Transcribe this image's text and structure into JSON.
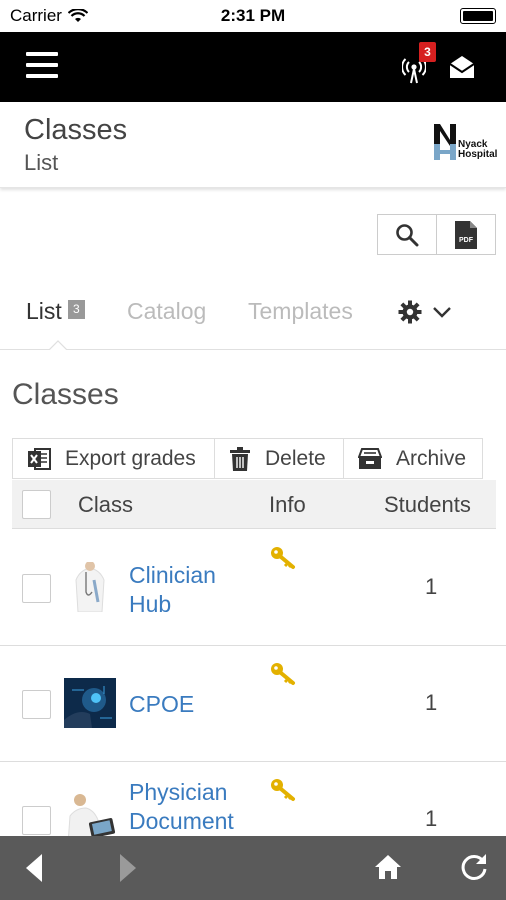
{
  "status_bar": {
    "carrier": "Carrier",
    "time": "2:31 PM"
  },
  "app_nav": {
    "notifications_count": "3"
  },
  "header": {
    "title": "Classes",
    "subtitle": "List",
    "logo_text_line1": "Nyack",
    "logo_text_line2": "Hospital"
  },
  "tool_buttons": {
    "pdf_label": "PDF"
  },
  "tabs": [
    {
      "label": "List",
      "count": "3"
    },
    {
      "label": "Catalog"
    },
    {
      "label": "Templates"
    }
  ],
  "section_title": "Classes",
  "actions": {
    "export": "Export grades",
    "delete": "Delete",
    "archive": "Archive"
  },
  "table": {
    "headers": {
      "class": "Class",
      "info": "Info",
      "students": "Students"
    },
    "rows": [
      {
        "name_line1": "Clinician",
        "name_line2": "Hub",
        "students": "1"
      },
      {
        "name_line1": "CPOE",
        "name_line2": "",
        "students": "1"
      },
      {
        "name_line1": "Physician",
        "name_line2": "Document",
        "students": "1"
      }
    ]
  },
  "colors": {
    "nav_bg": "#000000",
    "link": "#3a7bbf",
    "key": "#e3b100",
    "badge": "#d62020",
    "bottom_bar": "#5a5a5a"
  },
  "icons": [
    "wifi-icon",
    "battery-icon",
    "hamburger-icon",
    "signal-notification-icon",
    "mail-icon",
    "search-icon",
    "pdf-icon",
    "settings-gear-icon",
    "chevron-down-icon",
    "excel-icon",
    "trash-icon",
    "archive-icon",
    "key-icon",
    "back-arrow-icon",
    "forward-arrow-icon",
    "home-icon",
    "refresh-icon"
  ]
}
